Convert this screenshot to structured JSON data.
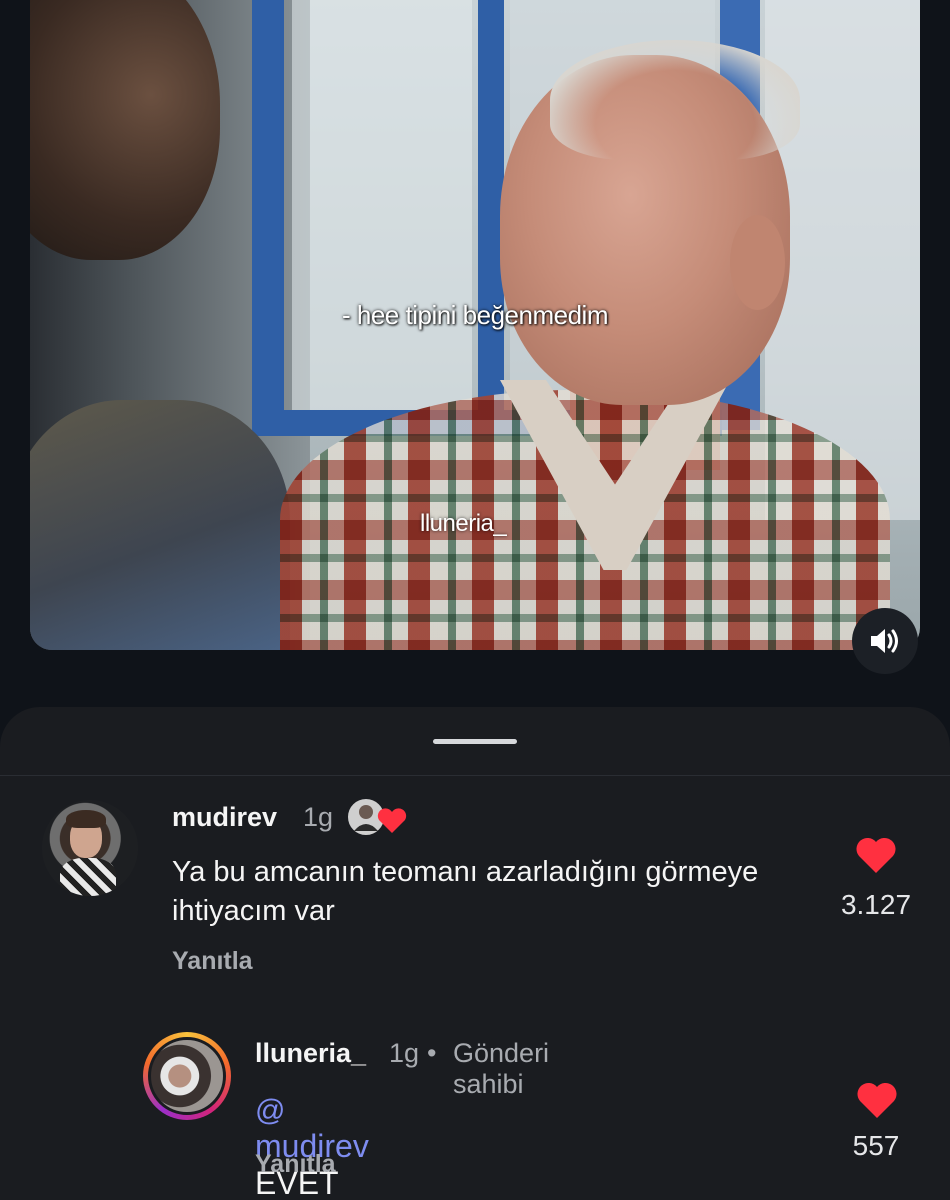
{
  "video": {
    "subtitle": "- hee tipini beğenmedim",
    "watermark": "lluneria_",
    "sound_icon": "speaker-icon"
  },
  "comments": [
    {
      "username": "mudirev",
      "time": "1g",
      "text": "Ya bu amcanın teomanı azarladığını görmeye ihtiyacım var",
      "reply_label": "Yanıtla",
      "likes": "3.127",
      "like_icon": "heart-icon",
      "liked_by_author": true
    },
    {
      "username": "lluneria_",
      "time": "1g",
      "separator": "•",
      "badge": "Gönderi sahibi",
      "mention": "mudirev",
      "text": "EVET EVET",
      "reply_label": "Yanıtla",
      "likes": "557",
      "like_icon": "heart-icon"
    }
  ],
  "colors": {
    "background": "#0f1319",
    "sheet": "#1a1c20",
    "heart": "#ff3040",
    "mention": "#7e8cf0",
    "muted_text": "#a8abb0"
  }
}
